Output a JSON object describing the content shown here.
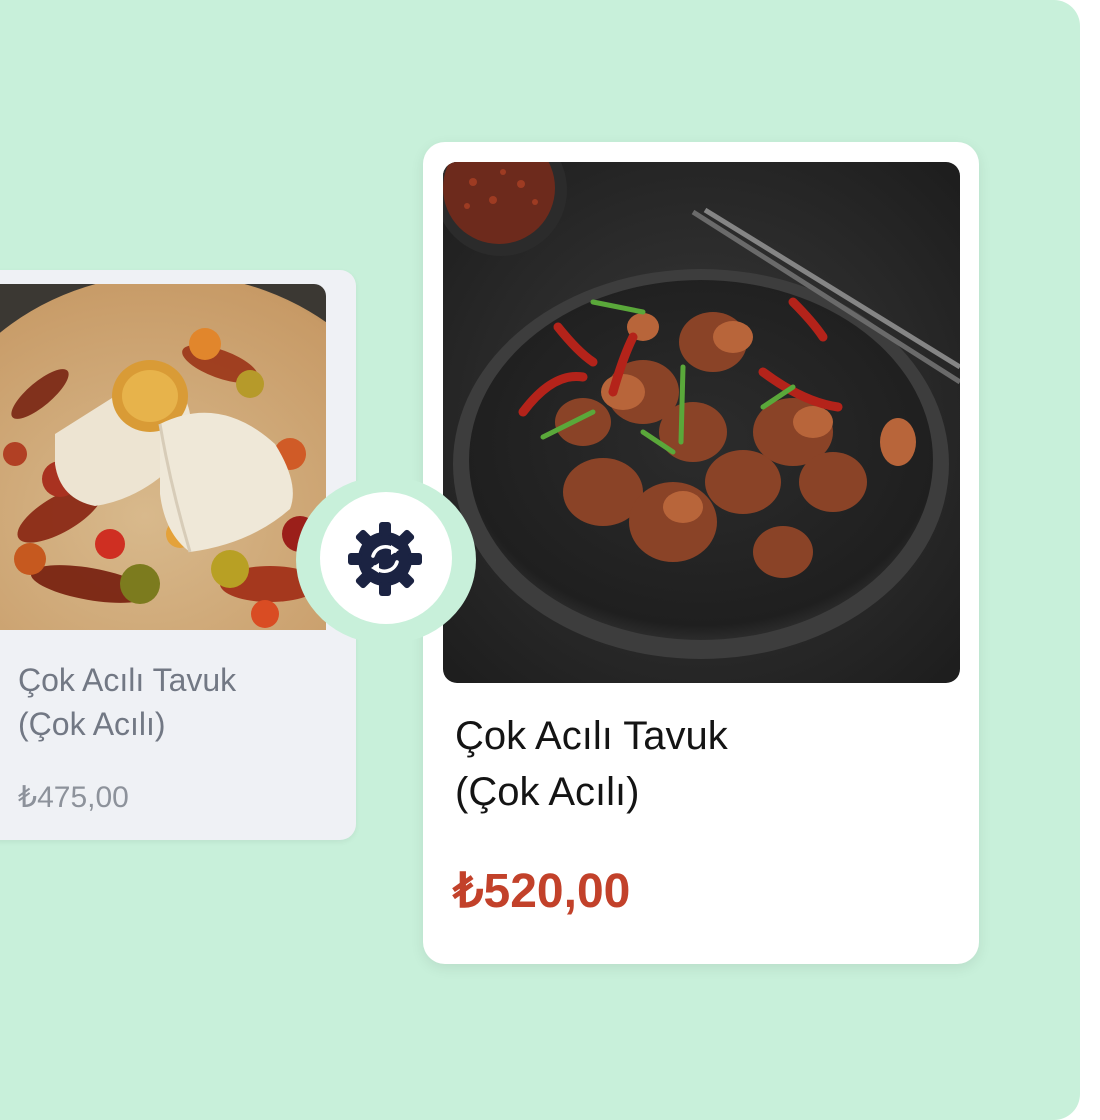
{
  "old_item": {
    "name_line1": "Çok Acılı Tavuk",
    "name_line2": "(Çok Acılı)",
    "price": "₺475,00",
    "image": "burrito-with-peppers-photo"
  },
  "new_item": {
    "name_line1": "Çok Acılı Tavuk",
    "name_line2": "(Çok Acılı)",
    "price": "₺520,00",
    "image": "spicy-chicken-plate-photo"
  },
  "sync_badge": {
    "icon": "gear-sync-icon"
  },
  "colors": {
    "background": "#c8f0da",
    "old_card": "#eff1f5",
    "new_card": "#ffffff",
    "new_price": "#c2412a",
    "old_price": "#8d929b",
    "icon": "#1b2342"
  }
}
